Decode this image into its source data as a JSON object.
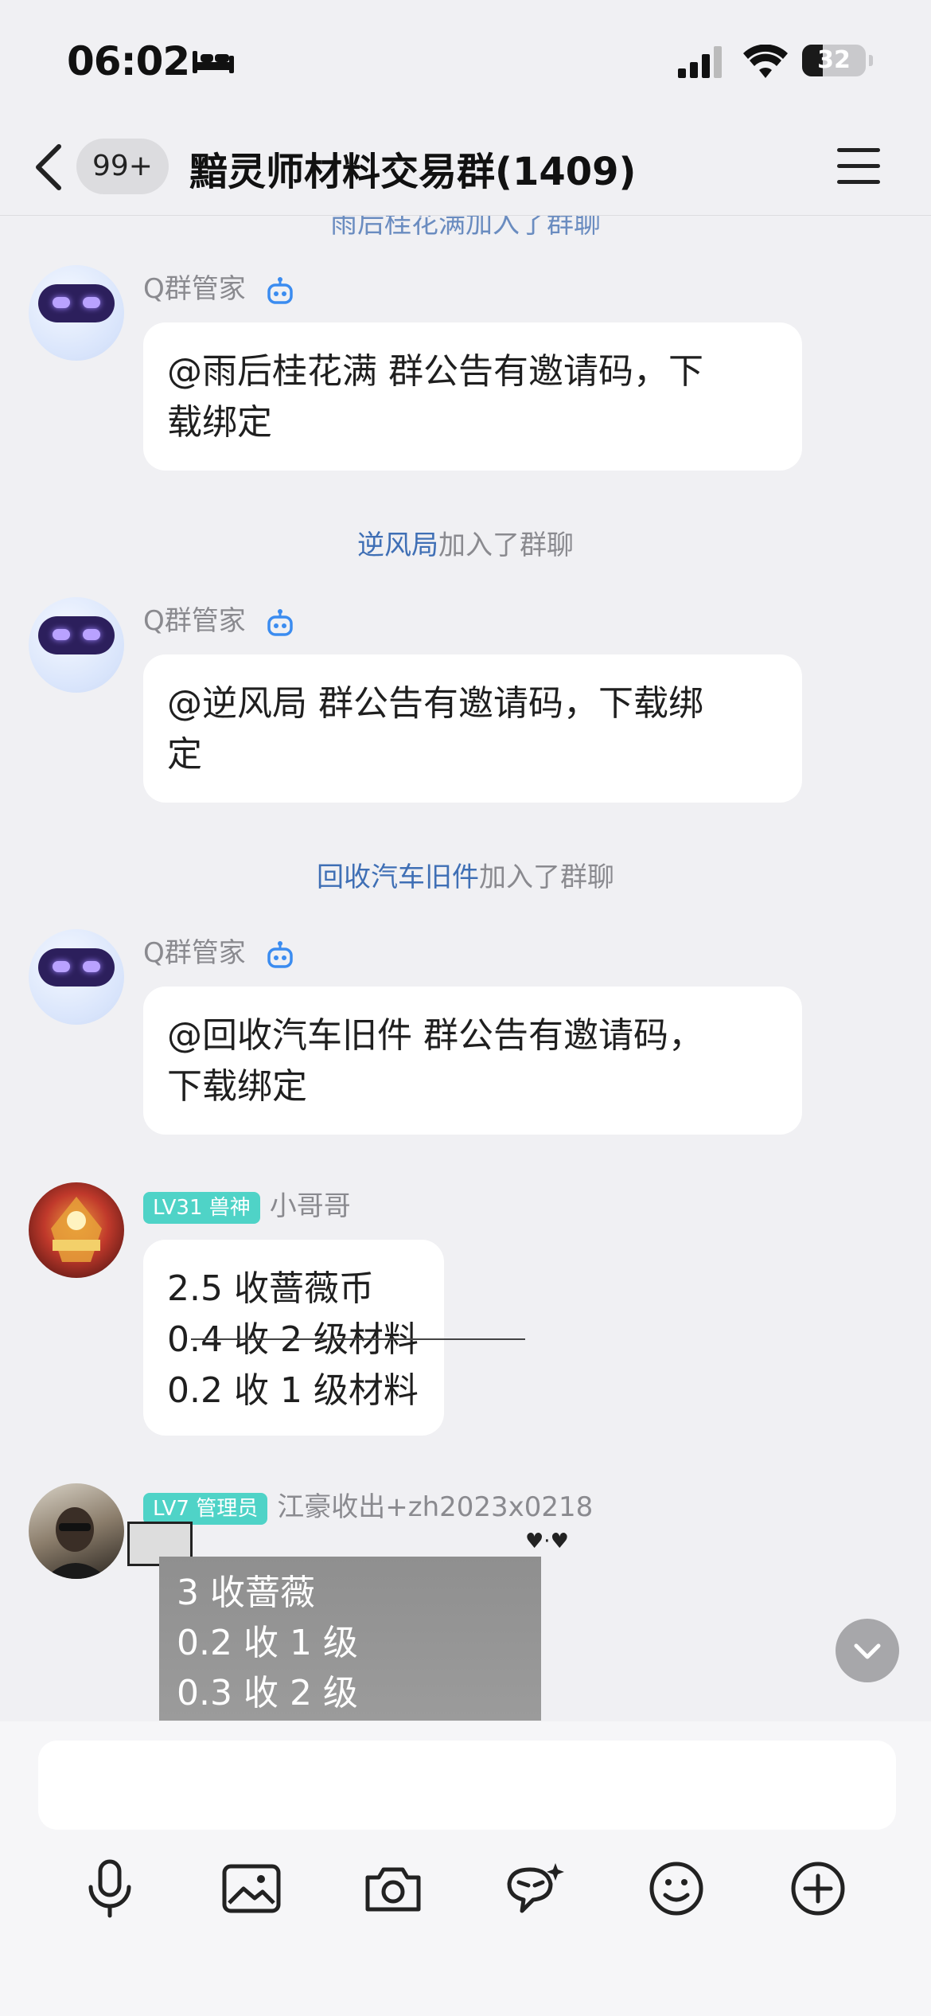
{
  "status_bar": {
    "time": "06:02",
    "battery": "32",
    "battery_level": 0.32
  },
  "nav": {
    "unread_count": "99+",
    "title": "黯灵师材料交易群(1409)"
  },
  "messages": [
    {
      "type": "system",
      "partial_text": "雨后桂花满加入了群聊"
    },
    {
      "type": "bot",
      "sender": "Q群管家",
      "text_lines": [
        "@雨后桂花满 群公告有邀请码，下",
        "载绑定"
      ]
    },
    {
      "type": "system",
      "name": "逆风局",
      "action": "加入了群聊"
    },
    {
      "type": "bot",
      "sender": "Q群管家",
      "text_lines": [
        "@逆风局 群公告有邀请码，下载绑",
        "定"
      ]
    },
    {
      "type": "system",
      "name": "回收汽车旧件",
      "action": "加入了群聊"
    },
    {
      "type": "bot",
      "sender": "Q群管家",
      "text_lines": [
        "@回收汽车旧件 群公告有邀请码，",
        "下载绑定"
      ]
    },
    {
      "type": "user",
      "level": "LV31 兽神",
      "sender": "小哥哥",
      "text_lines": [
        "2.5 收蔷薇币",
        "0.4 收 2 级材料",
        "0.2 收 1 级材料"
      ]
    },
    {
      "type": "user",
      "level": "LV7 管理员",
      "sender": "江豪收出+zh2023x0218",
      "text_lines": [
        "3 收蔷薇",
        "0.2 收 1 级",
        "0.3 收 2 级"
      ]
    }
  ],
  "input": {
    "placeholder": ""
  },
  "toolbar": [
    "microphone-icon",
    "image-icon",
    "camera-icon",
    "ai-assistant-icon",
    "emoji-icon",
    "plus-icon"
  ]
}
